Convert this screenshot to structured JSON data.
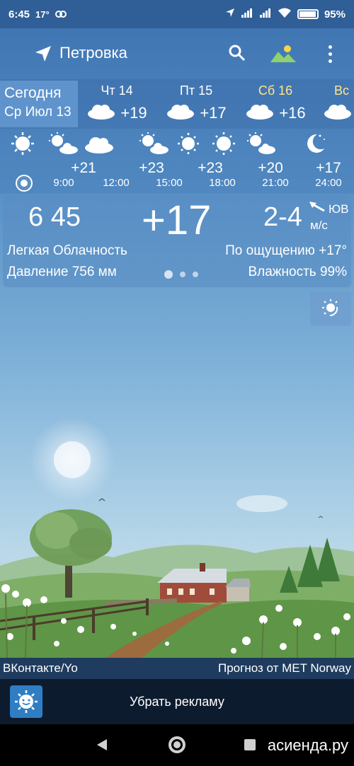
{
  "status_bar": {
    "time": "6:45",
    "temp_indicator": "17°",
    "battery": "95%"
  },
  "header": {
    "city": "Петровка"
  },
  "days": {
    "today": {
      "label": "Сегодня",
      "date": "Ср Июл 13"
    },
    "items": [
      {
        "label": "Чт 14",
        "temp": "+19",
        "icon": "cloud-icon"
      },
      {
        "label": "Пт 15",
        "temp": "+17",
        "icon": "cloud-icon"
      },
      {
        "label": "Сб 16",
        "temp": "+16",
        "icon": "cloud-icon",
        "weekend": true
      },
      {
        "label": "Вс",
        "temp": "",
        "icon": "cloud-icon"
      }
    ]
  },
  "hourly": [
    {
      "time": "9:00",
      "temp": "+21",
      "icon": "partly-cloudy-icon"
    },
    {
      "time": "12:00",
      "temp": "+23",
      "icon": "cloud-icon"
    },
    {
      "time": "15:00",
      "temp": "+23",
      "icon": "partly-cloudy-icon"
    },
    {
      "time": "18:00",
      "temp": "+23",
      "icon": "sun-icon"
    },
    {
      "time": "21:00",
      "temp": "+20",
      "icon": "sun-icon"
    },
    {
      "time": "24:00",
      "temp": "+17",
      "icon": "partly-cloudy-icon"
    },
    {
      "time": "",
      "temp": "",
      "icon": "moon-icon"
    }
  ],
  "current": {
    "time": "6 45",
    "temperature": "+17",
    "wind_speed": "2-4",
    "wind_direction": "ЮВ",
    "wind_unit": "м/с",
    "condition": "Легкая Облачность",
    "feels_like": "По ощущению +17°",
    "pressure": "Давление 756 мм",
    "humidity": "Влажность 99%"
  },
  "footer": {
    "left": "ВКонтакте/Yo",
    "right": "Прогноз от MET Norway"
  },
  "ad": {
    "text": "Убрать рекламу"
  },
  "watermark": "асиенда.ру",
  "colors": {
    "accent": "#5f93cc",
    "weekend": "#ffe58a",
    "adbar": "#0d1b2e"
  }
}
